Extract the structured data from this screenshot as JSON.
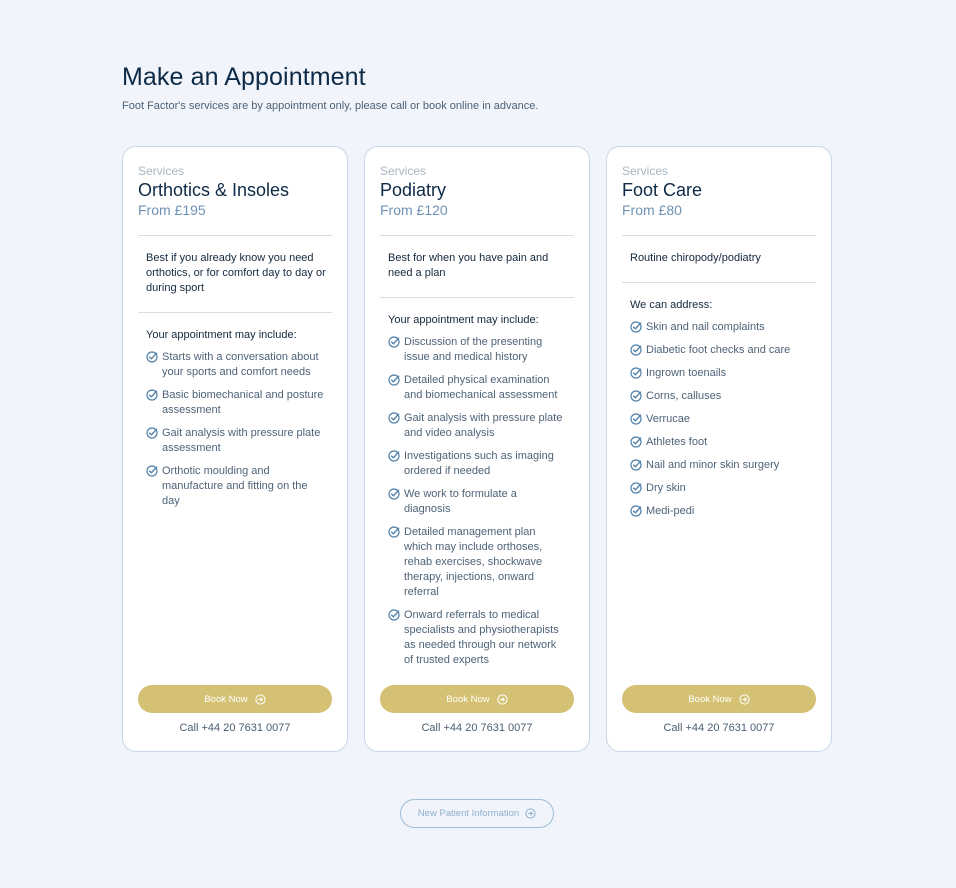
{
  "page": {
    "title": "Make an Appointment",
    "subtitle": "Foot Factor's services are by appointment only, please call or book online in advance."
  },
  "colors": {
    "background": "#f1f5fb",
    "accent_gold": "#d4c173",
    "navy": "#0d2a47",
    "price_blue": "#6e92b5",
    "check_blue": "#4f7fa8"
  },
  "icons": {
    "list_bullet": "check-circle-icon",
    "button_arrow": "arrow-right-circle-icon"
  },
  "cards": [
    {
      "eyebrow": "Services",
      "title": "Orthotics & Insoles",
      "price": "From £195",
      "description": "Best if you already know you need orthotics, or for comfort day to day or during sport",
      "list_heading": "Your appointment may include:",
      "items": [
        "Starts with a conversation about your sports and comfort needs",
        "Basic biomechanical and posture assessment",
        "Gait analysis with pressure plate assessment",
        "Orthotic moulding and manufacture and fitting on the day"
      ],
      "button": "Book Now",
      "call": "Call +44 20 7631 0077"
    },
    {
      "eyebrow": "Services",
      "title": "Podiatry",
      "price": "From £120",
      "description": "Best for when you have pain and need a plan",
      "list_heading": "Your appointment may include:",
      "items": [
        "Discussion of the presenting issue and medical history",
        "Detailed physical examination and biomechanical assessment",
        "Gait analysis with pressure plate and video analysis",
        "Investigations such as imaging ordered if needed",
        "We work to formulate a diagnosis",
        "Detailed management plan which may include orthoses, rehab exercises, shockwave therapy, injections, onward referral",
        "Onward referrals to medical specialists and physiotherapists as needed through our network of trusted experts"
      ],
      "button": "Book Now",
      "call": "Call +44 20 7631 0077"
    },
    {
      "eyebrow": "Services",
      "title": "Foot Care",
      "price": "From £80",
      "description": "Routine chiropody/podiatry",
      "list_heading": "We can address:",
      "items": [
        "Skin and nail complaints",
        "Diabetic foot checks and care",
        "Ingrown toenails",
        "Corns, calluses",
        "Verrucae",
        "Athletes foot",
        "Nail and minor skin surgery",
        "Dry skin",
        "Medi-pedi"
      ],
      "button": "Book Now",
      "call": "Call +44 20 7631 0077"
    }
  ],
  "footer": {
    "new_patient_button": "New Patient Information"
  }
}
